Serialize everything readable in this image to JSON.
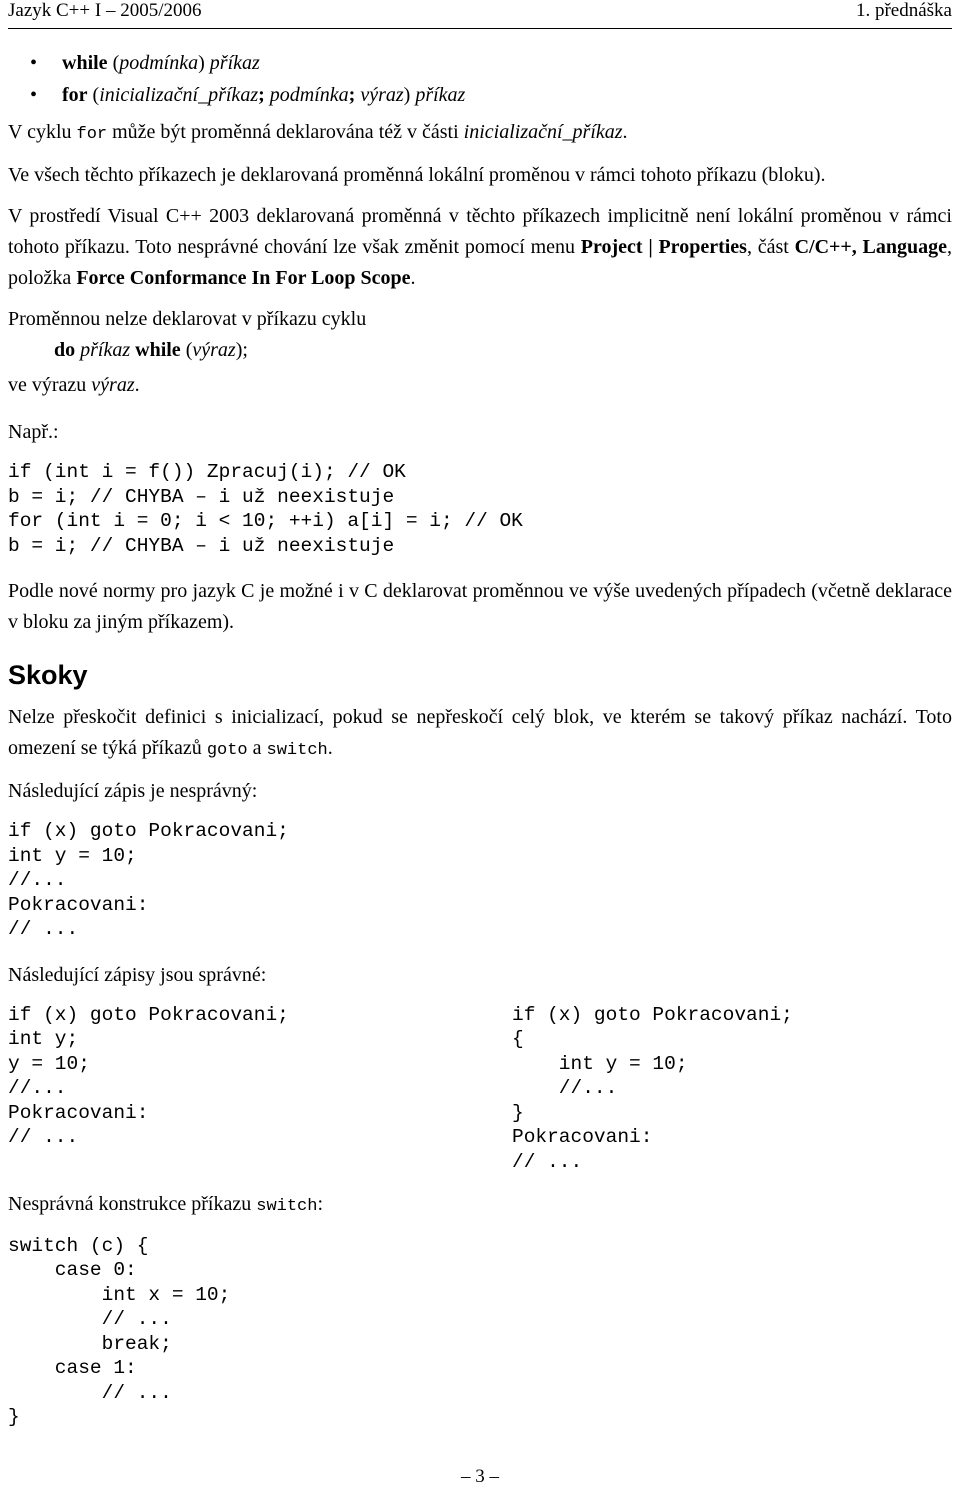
{
  "header": {
    "left": "Jazyk C++ I – 2005/2006",
    "right": "1. přednáška"
  },
  "bullets": [
    {
      "marker": "•",
      "keyword": "while",
      "rest_plain": " (",
      "rest_italic1": "podmínka",
      "rest_plain2": ") ",
      "rest_italic2": "příkaz"
    },
    {
      "marker": "•",
      "keyword": "for",
      "rest_plain": " (",
      "rest_italic1": "inicializační_příkaz",
      "semi1": "; ",
      "rest_italic2": "podmínka",
      "semi2": "; ",
      "rest_italic3": "výraz",
      "rest_plain2": ") ",
      "rest_italic4": "příkaz"
    }
  ],
  "paragraphs": {
    "for_cyklu_a": "V cyklu ",
    "for_cyklu_mono": "for",
    "for_cyklu_b": " může být proměnná deklarována též v části ",
    "for_cyklu_italic": "inicializační_příkaz",
    "for_cyklu_c": ".",
    "ve_vsech": "Ve všech těchto příkazech je deklarovaná proměnná lokální proměnou v rámci tohoto příkazu (bloku).",
    "visual_a": "V prostředí Visual C++ 2003 deklarovaná proměnná v těchto příkazech implicitně není lokální proměnou v rámci tohoto příkazu. Toto nesprávné chování lze však změnit pomocí menu ",
    "visual_b1": "Project | Properties",
    "visual_b2": ", část ",
    "visual_b3": "C/C++, Language",
    "visual_b4": ", položka ",
    "visual_b5": "Force Conformance In For Loop Scope",
    "visual_b6": ".",
    "promennou_nelze": "Proměnnou nelze deklarovat v příkazu cyklu",
    "do_while_do": "do ",
    "do_while_prikaz": "příkaz",
    "do_while_while": " while",
    "do_while_open": " (",
    "do_while_vyraz": "výraz",
    "do_while_close": ");",
    "ve_vyrazu_a": "ve výrazu ",
    "ve_vyrazu_it": "výraz",
    "ve_vyrazu_b": ".",
    "napr": "Např.:",
    "podle_nove": "Podle nové normy pro jazyk C je možné i v C deklarovat proměnnou ve výše uvedených případech (včetně deklarace v bloku za jiným příkazem).",
    "nelze_preskocit_a": "Nelze přeskočit definici s inicializací, pokud se nepřeskočí celý blok, ve kterém se takový příkaz nachází. Toto omezení se týká příkazů ",
    "nelze_preskocit_mono1": "goto",
    "nelze_preskocit_b": " a ",
    "nelze_preskocit_mono2": "switch",
    "nelze_preskocit_c": ".",
    "nasledujici_nespravny": "Následující zápis je nesprávný:",
    "nasledujici_spravne": "Následující zápisy jsou správné:",
    "nespravna_switch_a": "Nesprávná konstrukce příkazu ",
    "nespravna_switch_mono": "switch",
    "nespravna_switch_b": ":"
  },
  "headings": {
    "skoky": "Skoky"
  },
  "code_blocks": {
    "example_decl": "if (int i = f()) Zpracuj(i); // OK\nb = i; // CHYBA – i už neexistuje\nfor (int i = 0; i < 10; ++i) a[i] = i; // OK\nb = i; // CHYBA – i už neexistuje",
    "goto_wrong": "if (x) goto Pokracovani;\nint y = 10;\n//...\nPokracovani:\n// ...",
    "goto_ok_left": "if (x) goto Pokracovani;\nint y;\ny = 10;\n//...\nPokracovani:\n// ...",
    "goto_ok_right": "if (x) goto Pokracovani;\n{\n    int y = 10;\n    //...\n}\nPokracovani:\n// ...",
    "switch_wrong": "switch (c) {\n    case 0:\n        int x = 10;\n        // ...\n        break;\n    case 1:\n        // ...\n}"
  },
  "footer": {
    "page_number": "– 3 –"
  }
}
